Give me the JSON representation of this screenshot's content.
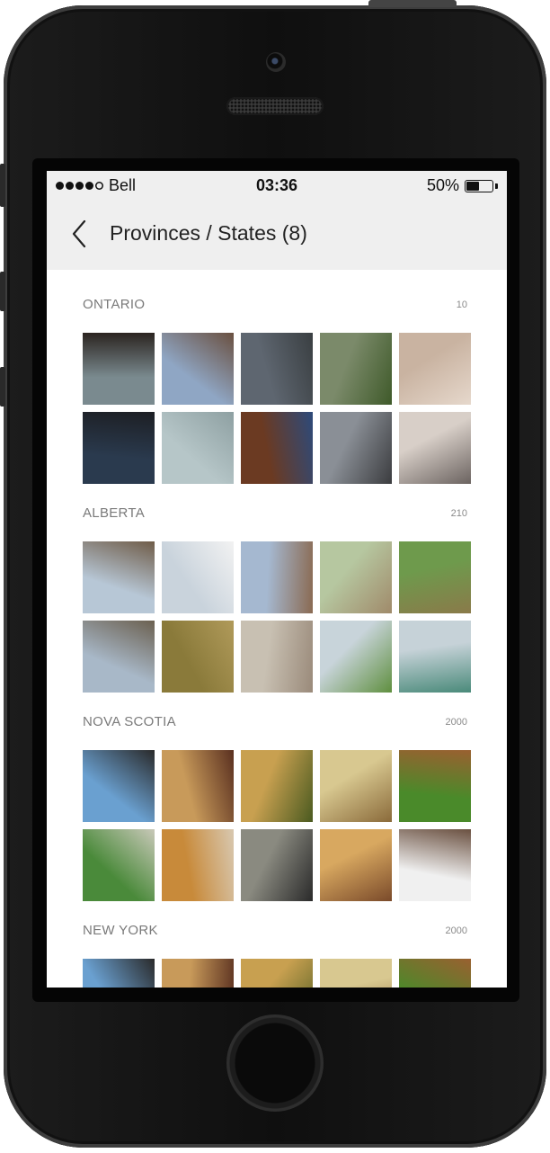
{
  "status_bar": {
    "carrier": "Bell",
    "time": "03:36",
    "battery": "50%",
    "signal_filled": 4,
    "signal_total": 5,
    "battery_level": 0.5
  },
  "nav": {
    "title": "Provinces / States (8)",
    "back_icon": "chevron-left-icon"
  },
  "sections": [
    {
      "name": "ONTARIO",
      "count": "10",
      "rows": 2,
      "thumbs": [
        {
          "c1": "#7a8a8f",
          "c2": "#2b2420"
        },
        {
          "c1": "#8fa6c4",
          "c2": "#6a5040"
        },
        {
          "c1": "#5e6670",
          "c2": "#3a3f42"
        },
        {
          "c1": "#7b8a6a",
          "c2": "#3f5a2a"
        },
        {
          "c1": "#c9b3a1",
          "c2": "#e6d8cc"
        },
        {
          "c1": "#2a3a4e",
          "c2": "#1d1f24"
        },
        {
          "c1": "#b6c6c8",
          "c2": "#8ea0a2"
        },
        {
          "c1": "#6b3a22",
          "c2": "#2d4a7a"
        },
        {
          "c1": "#8a8f96",
          "c2": "#3b3c3f"
        },
        {
          "c1": "#d8cfc8",
          "c2": "#6b6360"
        }
      ]
    },
    {
      "name": "ALBERTA",
      "count": "210",
      "rows": 2,
      "thumbs": [
        {
          "c1": "#b7c7d6",
          "c2": "#6f5c48"
        },
        {
          "c1": "#c9d3dc",
          "c2": "#f2f2f2"
        },
        {
          "c1": "#a5b8d0",
          "c2": "#8a6a52"
        },
        {
          "c1": "#b6c7a0",
          "c2": "#a08a6a"
        },
        {
          "c1": "#6e9a4c",
          "c2": "#8a7a4a"
        },
        {
          "c1": "#a8b8c8",
          "c2": "#6b6050"
        },
        {
          "c1": "#8a7a3a",
          "c2": "#b09a5a"
        },
        {
          "c1": "#c8c0b2",
          "c2": "#9a8a7a"
        },
        {
          "c1": "#c8d4da",
          "c2": "#5f8f3f"
        },
        {
          "c1": "#c6d2d8",
          "c2": "#4a8a7a"
        }
      ]
    },
    {
      "name": "NOVA SCOTIA",
      "count": "2000",
      "rows": 2,
      "thumbs": [
        {
          "c1": "#6aa0d0",
          "c2": "#2a2a2a"
        },
        {
          "c1": "#c89a5a",
          "c2": "#5a3020"
        },
        {
          "c1": "#c8a050",
          "c2": "#4a5a20"
        },
        {
          "c1": "#d8c890",
          "c2": "#8a6a3a"
        },
        {
          "c1": "#4a8a2a",
          "c2": "#9a6030"
        },
        {
          "c1": "#4a8a3a",
          "c2": "#c8c8b8"
        },
        {
          "c1": "#c88a3a",
          "c2": "#d8c8b0"
        },
        {
          "c1": "#8a8a80",
          "c2": "#2a2a2a"
        },
        {
          "c1": "#d8a860",
          "c2": "#7a4a2a"
        },
        {
          "c1": "#f0f0f0",
          "c2": "#6a5040"
        }
      ]
    },
    {
      "name": "NEW YORK",
      "count": "2000",
      "rows": 1,
      "thumbs": [
        {
          "c1": "#6aa0d0",
          "c2": "#2a2a2a"
        },
        {
          "c1": "#c89a5a",
          "c2": "#5a3020"
        },
        {
          "c1": "#c8a050",
          "c2": "#4a5a20"
        },
        {
          "c1": "#d8c890",
          "c2": "#8a6a3a"
        },
        {
          "c1": "#4a8a2a",
          "c2": "#9a6030"
        }
      ]
    }
  ]
}
